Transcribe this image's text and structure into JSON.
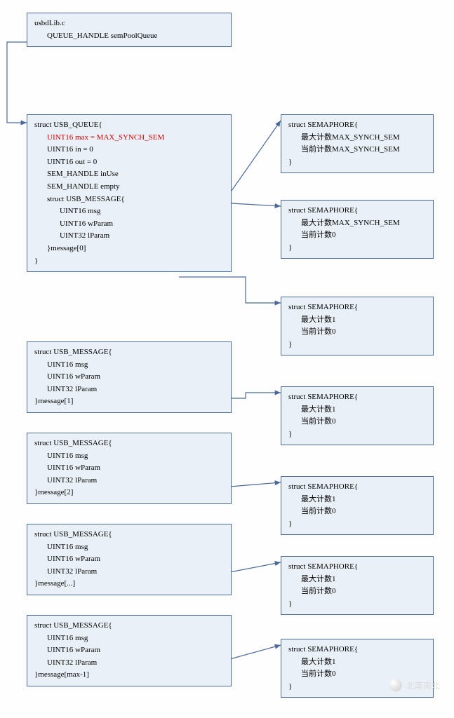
{
  "topbox": {
    "title": "usbdLib.c",
    "decl": "QUEUE_HANDLE semPoolQueue"
  },
  "queue": {
    "open": "struct USB_QUEUE{",
    "f1": "UINT16 max = MAX_SYNCH_SEM",
    "f2": "UINT16 in = 0",
    "f3": "UINT16 out = 0",
    "f4": "SEM_HANDLE inUse",
    "f5": "SEM_HANDLE empty",
    "innerOpen": "struct USB_MESSAGE{",
    "m1": "UINT16 msg",
    "m2": "UINT16 wParam",
    "m3": "UINT32 lParam",
    "innerClose": "}message[0]",
    "close": "}"
  },
  "msg1": {
    "open": "struct USB_MESSAGE{",
    "f1": "UINT16 msg",
    "f2": "UINT16 wParam",
    "f3": "UINT32 lParam",
    "close": "}message[1]"
  },
  "msg2": {
    "open": "struct USB_MESSAGE{",
    "f1": "UINT16 msg",
    "f2": "UINT16 wParam",
    "f3": "UINT32 lParam",
    "close": "}message[2]"
  },
  "msg3": {
    "open": "struct USB_MESSAGE{",
    "f1": "UINT16 msg",
    "f2": "UINT16 wParam",
    "f3": "UINT32 lParam",
    "close": "}message[...]"
  },
  "msg4": {
    "open": "struct USB_MESSAGE{",
    "f1": "UINT16 msg",
    "f2": "UINT16 wParam",
    "f3": "UINT32 lParam",
    "close": "}message[max-1]"
  },
  "sem1": {
    "open": "struct SEMAPHORE{",
    "l1": "最大计数MAX_SYNCH_SEM",
    "l2": "当前计数MAX_SYNCH_SEM",
    "close": "}"
  },
  "sem2": {
    "open": "struct SEMAPHORE{",
    "l1": "最大计数MAX_SYNCH_SEM",
    "l2": "当前计数0",
    "close": "}"
  },
  "sem3": {
    "open": "struct SEMAPHORE{",
    "l1": "最大计数1",
    "l2": "当前计数0",
    "close": "}"
  },
  "sem4": {
    "open": "struct SEMAPHORE{",
    "l1": "最大计数1",
    "l2": "当前计数0",
    "close": "}"
  },
  "sem5": {
    "open": "struct SEMAPHORE{",
    "l1": "最大计数1",
    "l2": "当前计数0",
    "close": "}"
  },
  "sem6": {
    "open": "struct SEMAPHORE{",
    "l1": "最大计数1",
    "l2": "当前计数0",
    "close": "}"
  },
  "sem7": {
    "open": "struct SEMAPHORE{",
    "l1": "最大计数1",
    "l2": "当前计数0",
    "close": "}"
  },
  "watermark": "北南南北"
}
